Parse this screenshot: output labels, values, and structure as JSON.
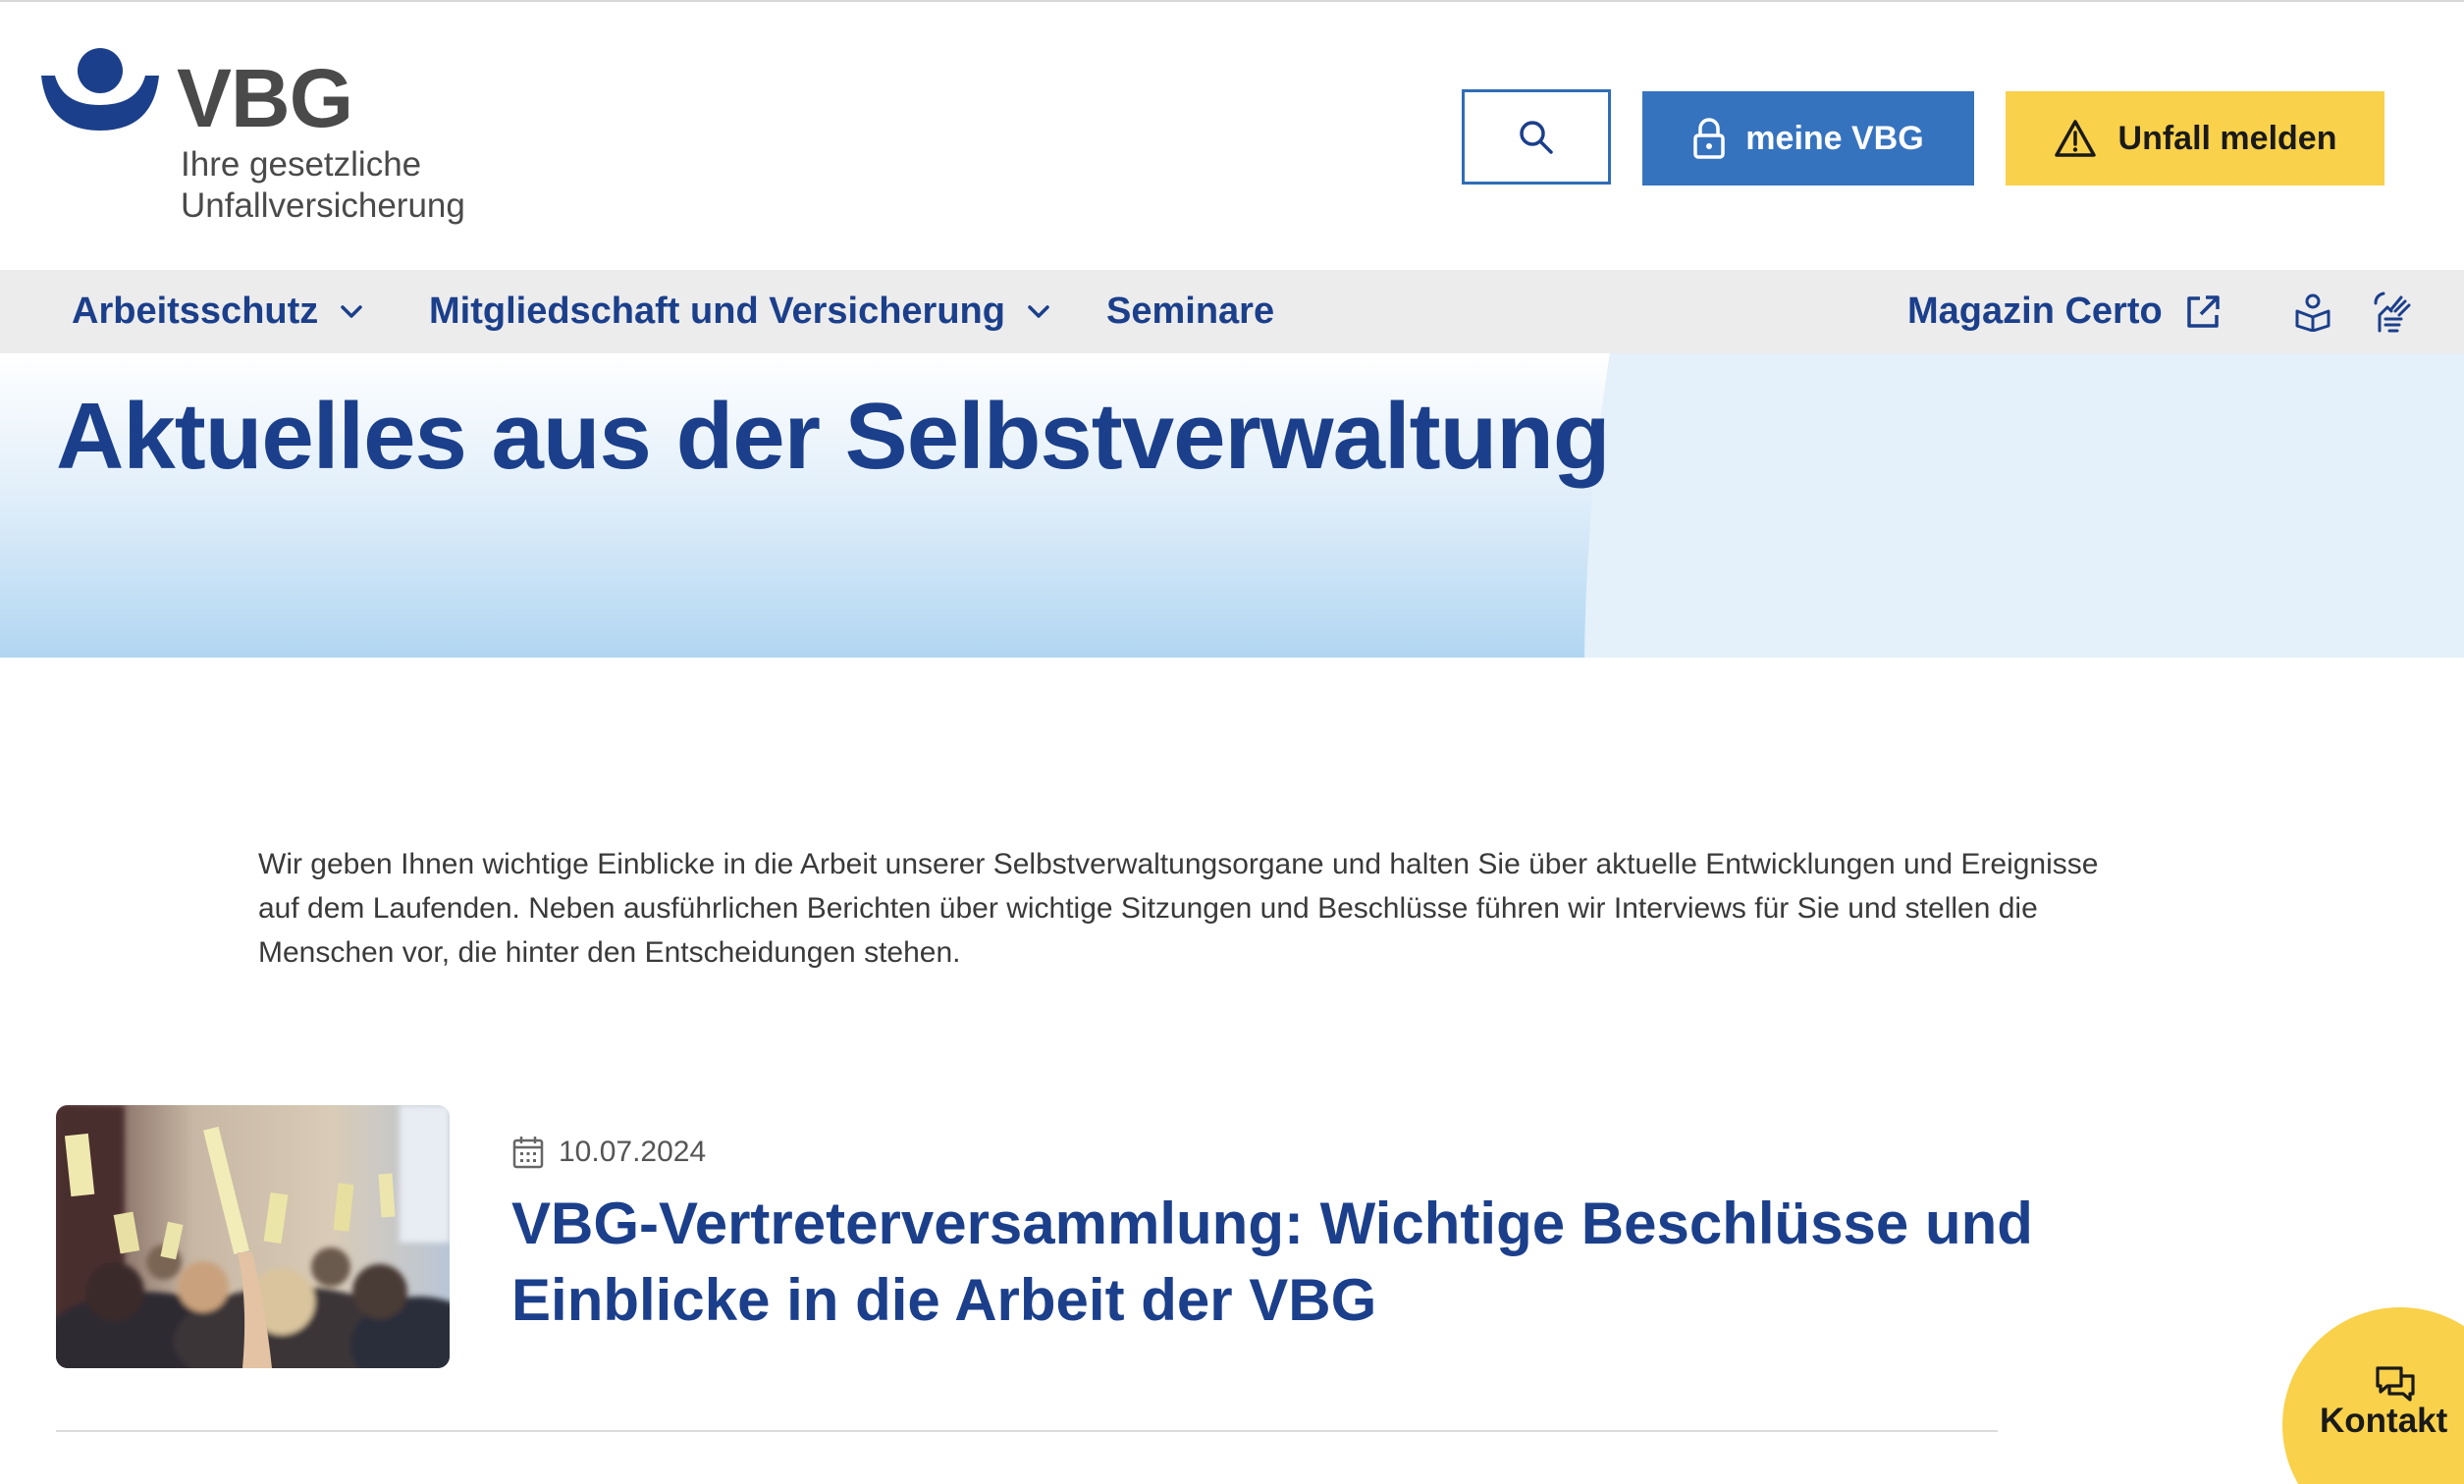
{
  "header": {
    "logo_word": "VBG",
    "logo_sub_line1": "Ihre gesetzliche",
    "logo_sub_line2": "Unfallversicherung",
    "meine_label": "meine VBG",
    "unfall_label": "Unfall melden",
    "search_icon": "search-icon",
    "lock_icon": "lock-icon",
    "warning_icon": "warning-icon"
  },
  "nav": {
    "items": [
      {
        "label": "Arbeitsschutz",
        "icon": "chevron-down-icon"
      },
      {
        "label": "Mitgliedschaft und Versicherung",
        "icon": "chevron-down-icon"
      },
      {
        "label": "Seminare"
      }
    ],
    "magazin_label": "Magazin Certo",
    "magazin_icon": "external-link-icon",
    "easy_language_icon": "easy-language-icon",
    "sign_language_icon": "sign-language-icon"
  },
  "hero": {
    "title": "Aktuelles aus der Selbstverwaltung"
  },
  "intro": {
    "line1": "Wir geben Ihnen wichtige Einblicke in die Arbeit unserer Selbstverwaltungsorgane und halten Sie über aktuelle Entwicklungen und Ereignisse",
    "line2": "auf dem Laufenden. Neben ausführlichen Berichten über wichtige Sitzungen und Beschlüsse führen wir Interviews für Sie und stellen die",
    "line3": "Menschen vor, die hinter den Entscheidungen stehen."
  },
  "teaser": {
    "date": "10.07.2024",
    "title_line1": "VBG-Vertreterversammlung: Wichtige Beschlüsse und",
    "title_line2": "Einblicke in die Arbeit der VBG",
    "calendar_icon": "calendar-icon"
  },
  "contact": {
    "label": "Kontakt",
    "icon": "chat-icon"
  },
  "colors": {
    "brand_blue": "#1b3f8b",
    "button_blue": "#3673be",
    "accent_yellow": "#f9d14a",
    "nav_bg": "#ececec",
    "hero_light": "#e3eff9"
  }
}
